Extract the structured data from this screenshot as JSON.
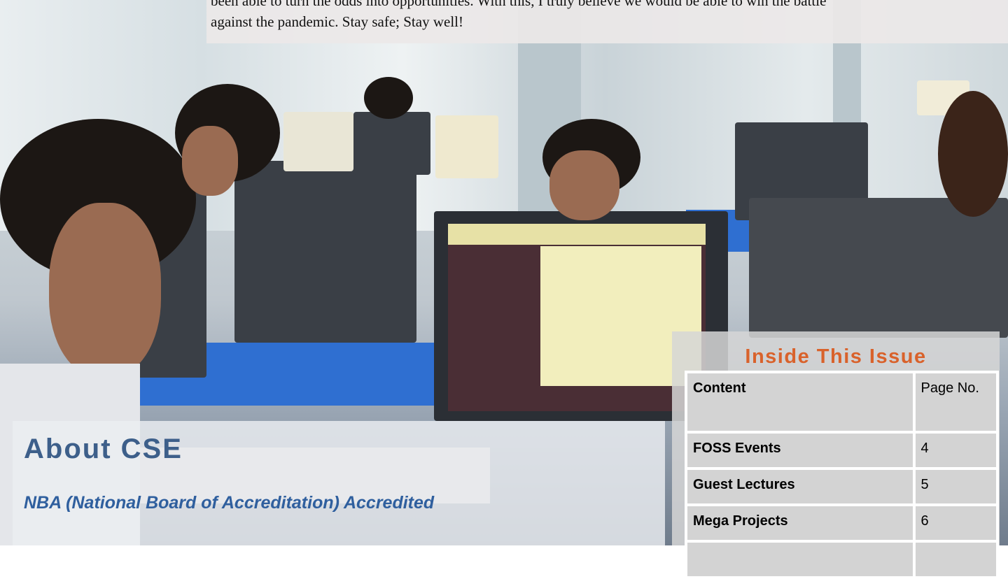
{
  "top_note": {
    "line1": "been able to turn the odds into opportunities. With this, I truly believe we would be able to win the battle",
    "line2": "against the pandemic. Stay safe; Stay well!"
  },
  "about": {
    "title": "About CSE",
    "subtitle": "NBA (National Board of Accreditation) Accredited",
    "title_color": "#3d5f8a",
    "subtitle_color": "#2f5f9e"
  },
  "inside_issue": {
    "title": "Inside This Issue",
    "title_color": "#d9622b",
    "header": {
      "content": "Content",
      "page": "Page No."
    },
    "rows": [
      {
        "content": "FOSS Events",
        "page": "4"
      },
      {
        "content": "Guest Lectures",
        "page": "5"
      },
      {
        "content": "Mega Projects",
        "page": "6"
      }
    ]
  },
  "background": {
    "description_icon": "computer-lab-photo",
    "desk_color": "#2f6fd1"
  }
}
